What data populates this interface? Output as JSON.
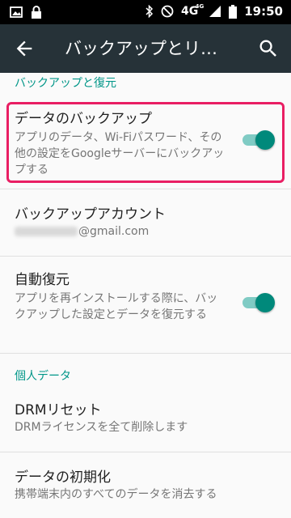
{
  "status_bar": {
    "time": "19:50",
    "network": "4G",
    "network_sup": "4G"
  },
  "toolbar": {
    "title": "バックアップとリ…"
  },
  "sections": {
    "backup_header": "バックアップと復元",
    "personal_header": "個人データ"
  },
  "items": {
    "data_backup": {
      "title": "データのバックアップ",
      "summary": "アプリのデータ、Wi-Fiパスワード、その他の設定をGoogleサーバーにバックアップする",
      "enabled": true
    },
    "backup_account": {
      "title": "バックアップアカウント",
      "email_suffix": "@gmail.com"
    },
    "auto_restore": {
      "title": "自動復元",
      "summary": "アプリを再インストールする際に、バックアップした設定とデータを復元する",
      "enabled": true
    },
    "drm_reset": {
      "title": "DRMリセット",
      "summary": "DRMライセンスを全て削除します"
    },
    "factory_reset": {
      "title": "データの初期化",
      "summary": "携帯端末内のすべてのデータを消去する"
    }
  },
  "colors": {
    "accent": "#009688",
    "toolbar": "#263238",
    "highlight": "#e91e63"
  }
}
